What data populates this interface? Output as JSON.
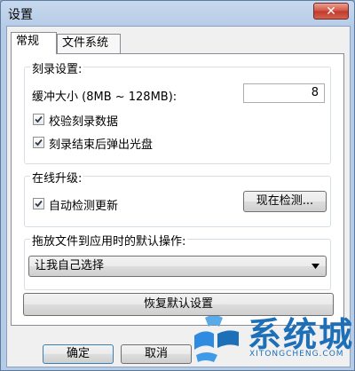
{
  "window": {
    "title": "设置",
    "close_symbol": "✕"
  },
  "tabs": [
    {
      "label": "常规",
      "active": true
    },
    {
      "label": "文件系统",
      "active": false
    }
  ],
  "burn_settings": {
    "title": "刻录设置:",
    "buffer_label": "缓冲大小 (8MB ~ 128MB):",
    "buffer_value": "8",
    "verify_label": "校验刻录数据",
    "verify_checked": true,
    "eject_label": "刻录结束后弹出光盘",
    "eject_checked": true
  },
  "online_upgrade": {
    "title": "在线升级:",
    "auto_check_label": "自动检测更新",
    "auto_check_checked": true,
    "check_now_label": "现在检测..."
  },
  "drag_action": {
    "title": "拖放文件到应用时的默认操作:",
    "selected": "让我自己选择"
  },
  "restore_defaults_label": "恢复默认设置",
  "footer": {
    "ok_label": "确定",
    "cancel_label": "取消"
  },
  "watermark": {
    "text": "系统城",
    "subtext": "XITONGCHENG.COM"
  }
}
